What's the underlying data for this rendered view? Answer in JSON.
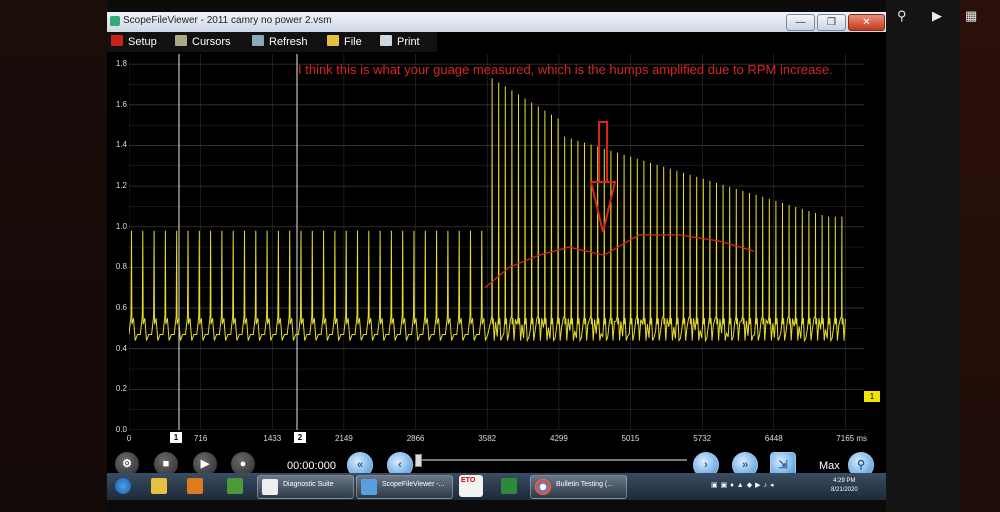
{
  "window": {
    "title": "ScopeFileViewer - 2011 camry no power 2.vsm",
    "min": "—",
    "max": "❐",
    "close": "✕"
  },
  "overlay": {
    "search_icon": "⚲",
    "play_icon": "▶",
    "grid_icon": "▦"
  },
  "toolbar": {
    "setup": "Setup",
    "cursors": "Cursors",
    "refresh": "Refresh",
    "file": "File",
    "print": "Print"
  },
  "plot": {
    "y_ticks": [
      "1.8",
      "1.6",
      "1.4",
      "1.2",
      "1.0",
      "0.8",
      "0.6",
      "0.4",
      "0.2",
      "0.0"
    ],
    "x_ticks": [
      "0",
      "716",
      "1433",
      "2149",
      "2866",
      "3582",
      "4299",
      "5015",
      "5732",
      "6448",
      "7165 ms"
    ],
    "cursor_x_labels": [
      "1",
      "2"
    ],
    "cursor_tag": "1",
    "annotation": "I think this is what your guage measured, which is the humps amplified due to RPM increase.",
    "colors": {
      "trace": "#e6dc2c",
      "envelope": "#d8261e",
      "grid": "#3a3a3a"
    }
  },
  "playback": {
    "time": "00:00:000",
    "max_label": "Max",
    "position_fraction": 0.0
  },
  "taskbar": {
    "apps": [
      "Diagnostic Suite",
      "ScopeFileViewer -...",
      "Bulletin Testing (..."
    ],
    "eto_label": "ETO",
    "clock_time": "4:29 PM",
    "clock_date": "8/21/2020"
  }
}
